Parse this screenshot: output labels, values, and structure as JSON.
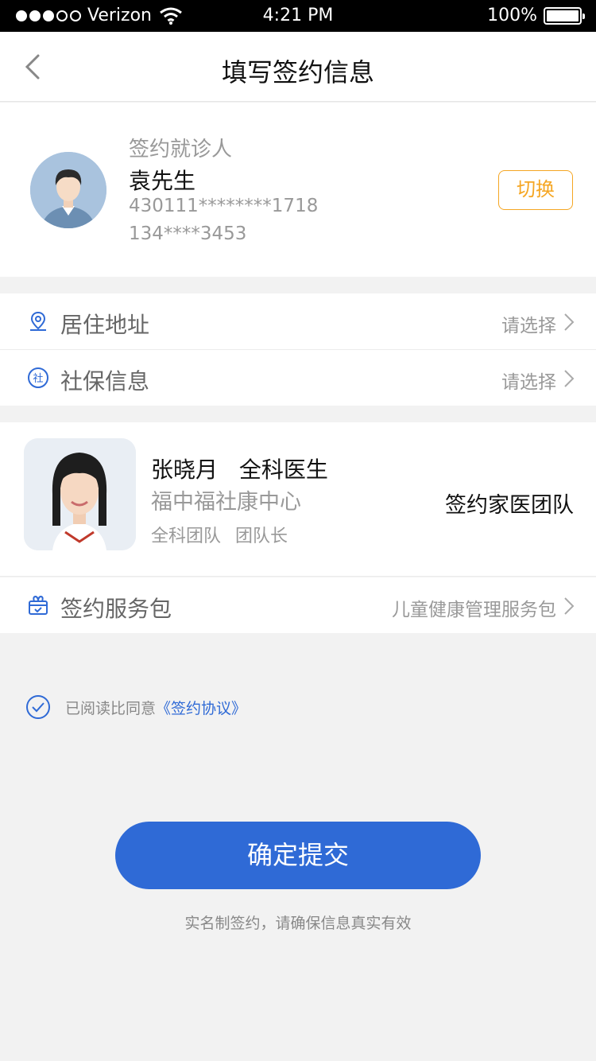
{
  "status_bar": {
    "carrier": "Verizon",
    "time": "4:21 PM",
    "battery": "100%"
  },
  "nav": {
    "title": "填写签约信息",
    "back_icon": "chevron-left-icon"
  },
  "patient": {
    "label": "签约就诊人",
    "name": "袁先生",
    "id_number": "430111********1718",
    "phone": "134****3453",
    "switch_label": "切换"
  },
  "rows": {
    "address": {
      "label": "居住地址",
      "value": "请选择",
      "icon": "location-pin-icon"
    },
    "social": {
      "label": "社保信息",
      "value": "请选择",
      "icon": "social-security-icon",
      "icon_char": "社"
    },
    "package": {
      "label": "签约服务包",
      "value": "儿童健康管理服务包",
      "icon": "gift-box-icon"
    }
  },
  "doctor": {
    "name": "张晓月",
    "title": "全科医生",
    "center": "福中福社康中心",
    "team": "全科团队",
    "role": "团队长",
    "right_label": "签约家医团队"
  },
  "agreement": {
    "text": "已阅读比同意",
    "link": "《签约协议》",
    "checked": true
  },
  "submit": {
    "label": "确定提交",
    "note": "实名制签约，请确保信息真实有效"
  },
  "colors": {
    "accent": "#2f6ad6",
    "switch": "#f5a623",
    "background": "#f2f2f2"
  }
}
